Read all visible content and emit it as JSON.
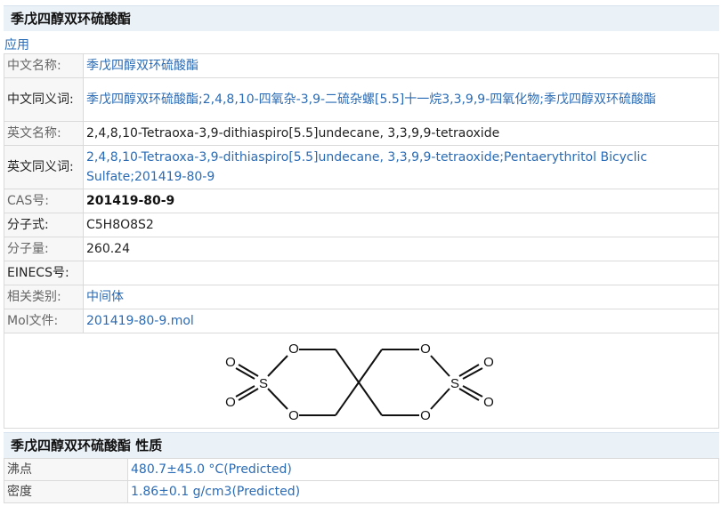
{
  "title": "季戊四醇双环硫酸酯",
  "apply_link": "应用",
  "rows": [
    {
      "label": "中文名称:",
      "value": "季戊四醇双环硫酸酯"
    },
    {
      "label": "中文同义词:",
      "value": "季戊四醇双环硫酸酯;2,4,8,10-四氧杂-3,9-二硫杂螺[5.5]十一烷3,3,9,9-四氧化物;季戊四醇双环硫酸酯"
    },
    {
      "label": "英文名称:",
      "value": "2,4,8,10-Tetraoxa-3,9-dithiaspiro[5.5]undecane, 3,3,9,9-tetraoxide"
    },
    {
      "label": "英文同义词:",
      "value": "2,4,8,10-Tetraoxa-3,9-dithiaspiro[5.5]undecane, 3,3,9,9-tetraoxide;Pentaerythritol Bicyclic Sulfate;201419-80-9"
    },
    {
      "label": "CAS号:",
      "value": "201419-80-9"
    },
    {
      "label": "分子式:",
      "value": "C5H8O8S2"
    },
    {
      "label": "分子量:",
      "value": "260.24"
    },
    {
      "label": "EINECS号:",
      "value": ""
    },
    {
      "label": "相关类别:",
      "value": "中间体"
    },
    {
      "label": "Mol文件:",
      "value": "201419-80-9.mol"
    }
  ],
  "structure": {
    "atoms": {
      "O": "O",
      "S": "S"
    }
  },
  "properties_title": "季戊四醇双环硫酸酯 性质",
  "properties": [
    {
      "label": "沸点",
      "value": "480.7±45.0 °C(Predicted)"
    },
    {
      "label": "密度",
      "value": "1.86±0.1 g/cm3(Predicted)"
    }
  ]
}
